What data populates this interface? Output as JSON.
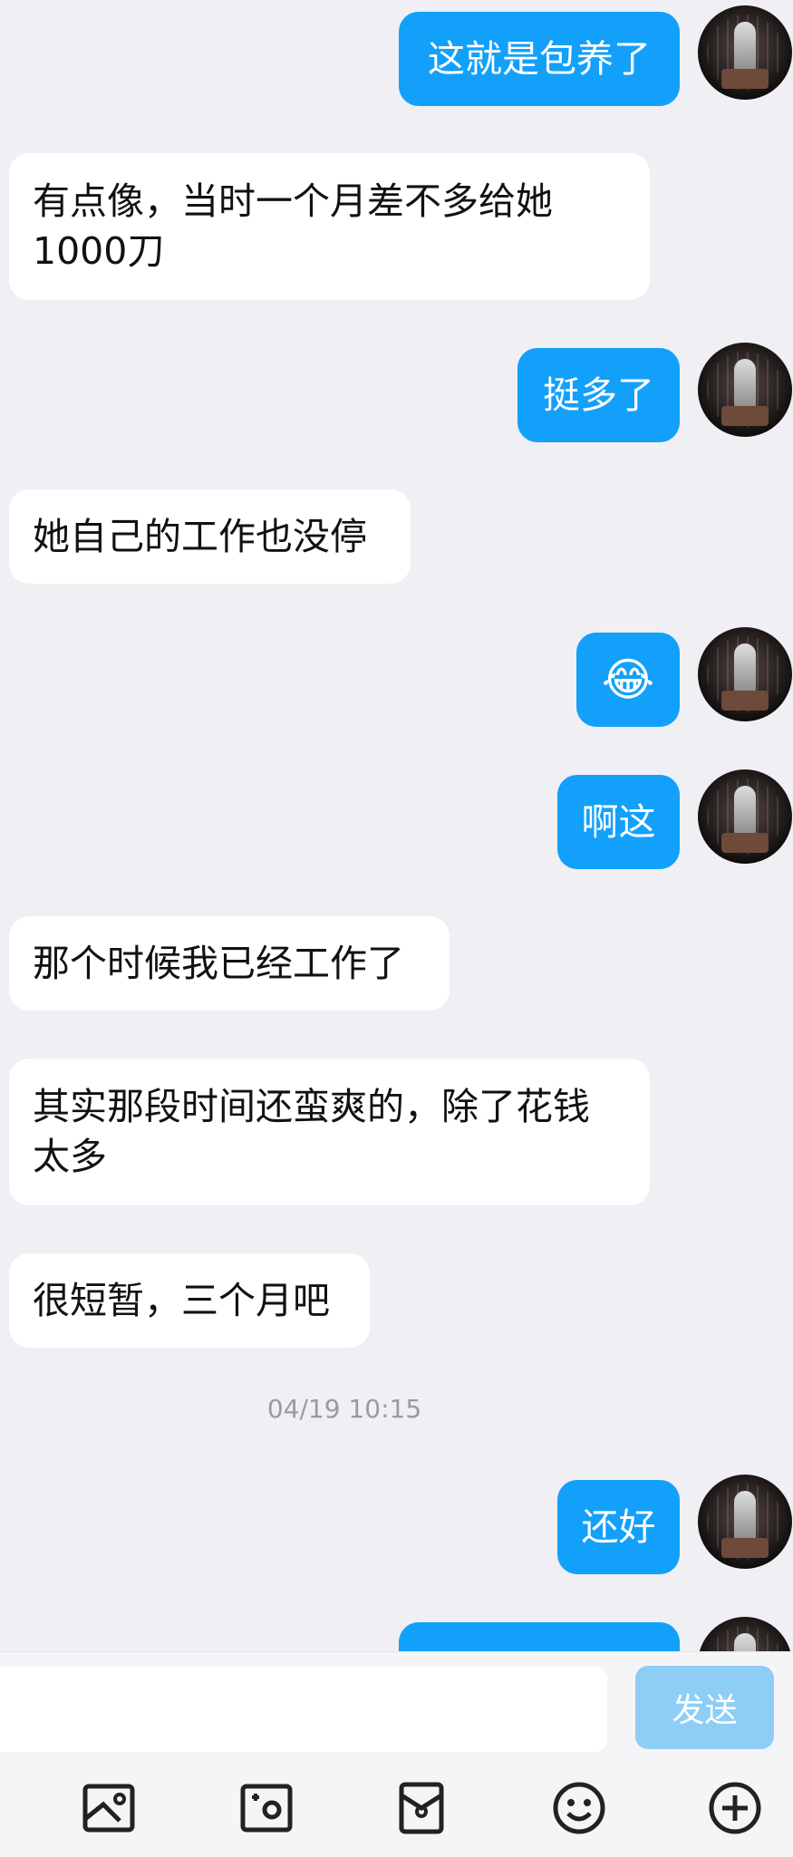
{
  "messages": [
    {
      "sender": "me",
      "text": "这就是包养了"
    },
    {
      "sender": "them",
      "text": "有点像，当时一个月差不多给她\n1000刀"
    },
    {
      "sender": "me",
      "text": "挺多了"
    },
    {
      "sender": "them",
      "text": "她自己的工作也没停"
    },
    {
      "sender": "me",
      "text": "😂"
    },
    {
      "sender": "me",
      "text": "啊这"
    },
    {
      "sender": "them",
      "text": "那个时候我已经工作了"
    },
    {
      "sender": "them",
      "text": "其实那段时间还蛮爽的，除了花钱\n太多"
    },
    {
      "sender": "them",
      "text": "很短暂，三个月吧"
    },
    {
      "sender": "me",
      "text": "还好"
    }
  ],
  "timestamp": "04/19 10:15",
  "input": {
    "value": "",
    "placeholder": ""
  },
  "send_label": "发送",
  "toolbar_icons": [
    "image-icon",
    "camera-icon",
    "red-packet-icon",
    "emoji-icon",
    "plus-icon"
  ],
  "colors": {
    "my_bubble": "#12a0fa",
    "their_bubble": "#ffffff",
    "background": "#efeff4",
    "send_button": "#8ecdf6"
  }
}
